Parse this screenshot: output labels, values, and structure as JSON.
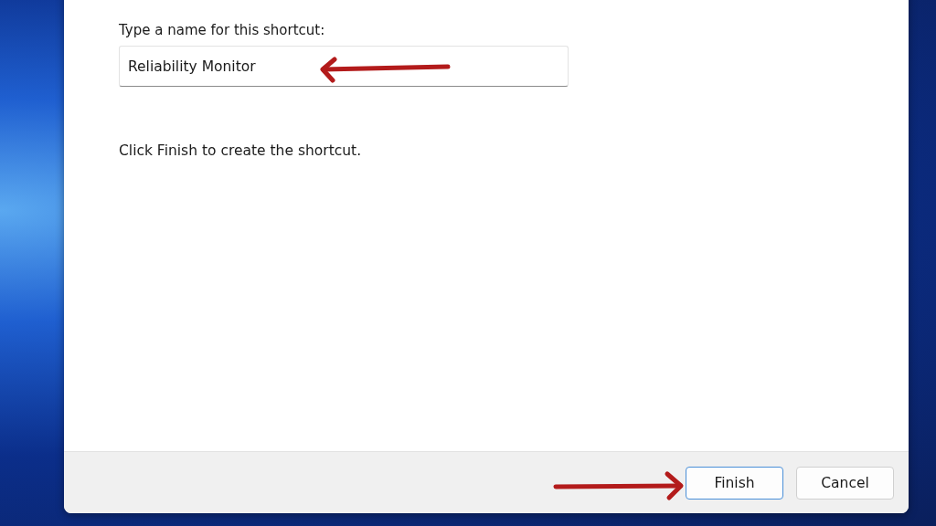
{
  "name_field": {
    "label": "Type a name for this shortcut:",
    "value": "Reliability Monitor"
  },
  "instruction": "Click Finish to create the shortcut.",
  "buttons": [
    {
      "label": "Finish",
      "default": true
    },
    {
      "label": "Cancel",
      "default": false
    }
  ]
}
